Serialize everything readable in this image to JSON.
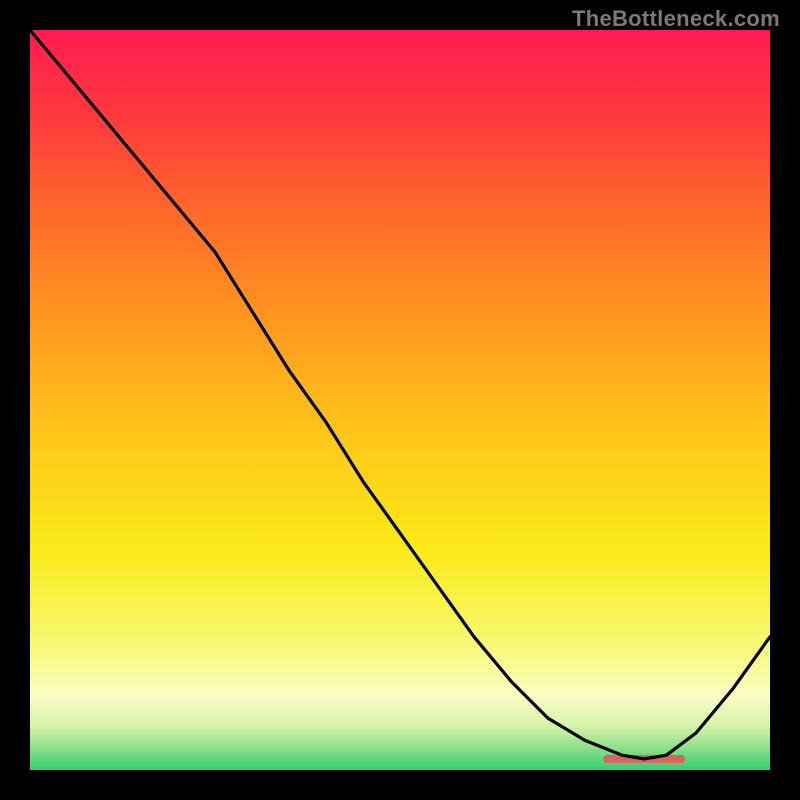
{
  "watermark": "TheBottleneck.com",
  "gradient": {
    "stops": [
      {
        "offset": 0.0,
        "color": "#ff1b52"
      },
      {
        "offset": 0.12,
        "color": "#ff3a3d"
      },
      {
        "offset": 0.25,
        "color": "#ff6a2a"
      },
      {
        "offset": 0.4,
        "color": "#ff9a1e"
      },
      {
        "offset": 0.55,
        "color": "#ffc71a"
      },
      {
        "offset": 0.7,
        "color": "#fbe918"
      },
      {
        "offset": 0.82,
        "color": "#f7f86a"
      },
      {
        "offset": 0.9,
        "color": "#fbfcc4"
      },
      {
        "offset": 0.94,
        "color": "#d7f3a8"
      },
      {
        "offset": 0.97,
        "color": "#8de08a"
      },
      {
        "offset": 1.0,
        "color": "#2fd06e"
      }
    ]
  },
  "marker": {
    "x_start": 0.78,
    "x_end": 0.88,
    "y": 0.985,
    "color": "#d9635f",
    "thickness": 8
  },
  "chart_data": {
    "type": "line",
    "title": "",
    "xlabel": "",
    "ylabel": "",
    "xlim": [
      0,
      1
    ],
    "ylim": [
      0,
      1
    ],
    "grid": false,
    "legend": false,
    "series": [
      {
        "name": "curve",
        "x": [
          0.0,
          0.05,
          0.1,
          0.15,
          0.2,
          0.25,
          0.3,
          0.35,
          0.4,
          0.45,
          0.5,
          0.55,
          0.6,
          0.65,
          0.7,
          0.75,
          0.8,
          0.83,
          0.86,
          0.9,
          0.95,
          1.0
        ],
        "y": [
          1.0,
          0.94,
          0.88,
          0.82,
          0.76,
          0.7,
          0.62,
          0.54,
          0.47,
          0.39,
          0.32,
          0.25,
          0.18,
          0.12,
          0.07,
          0.04,
          0.02,
          0.015,
          0.02,
          0.05,
          0.11,
          0.18
        ]
      }
    ]
  }
}
